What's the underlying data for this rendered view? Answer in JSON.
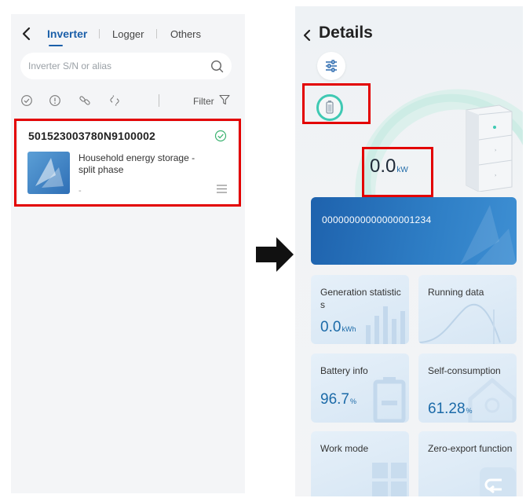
{
  "left_screen": {
    "tabs": [
      {
        "label": "Inverter",
        "active": true
      },
      {
        "label": "Logger",
        "active": false
      },
      {
        "label": "Others",
        "active": false
      }
    ],
    "search": {
      "placeholder": "Inverter S/N or alias"
    },
    "filter_label": "Filter",
    "filter_icons": [
      "check-circle-icon",
      "info-circle-icon",
      "link-icon",
      "broken-link-icon"
    ],
    "device_card": {
      "serial": "501523003780N9100002",
      "description": "Household energy storage - split phase",
      "sub": "-",
      "status_icon": "check-circle-icon"
    }
  },
  "right_screen": {
    "title": "Details",
    "power": {
      "value": "0.0",
      "unit": "kW"
    },
    "serial_banner": "00000000000000001234",
    "tiles": [
      {
        "label": "Generation statistics",
        "value": "0.0",
        "unit": "kWh"
      },
      {
        "label": "Running data",
        "value": "",
        "unit": ""
      },
      {
        "label": "Battery info",
        "value": "96.7",
        "unit": "%"
      },
      {
        "label": "Self-consumption",
        "value": "61.28",
        "unit": "%"
      },
      {
        "label": "Work mode",
        "value": "",
        "unit": ""
      },
      {
        "label": "Zero-export function",
        "value": "",
        "unit": ""
      }
    ]
  },
  "colors": {
    "accent_blue": "#1b5fa9",
    "highlight_red": "#e30000",
    "gauge_teal": "#3fc9b3",
    "check_green": "#3cb371"
  }
}
